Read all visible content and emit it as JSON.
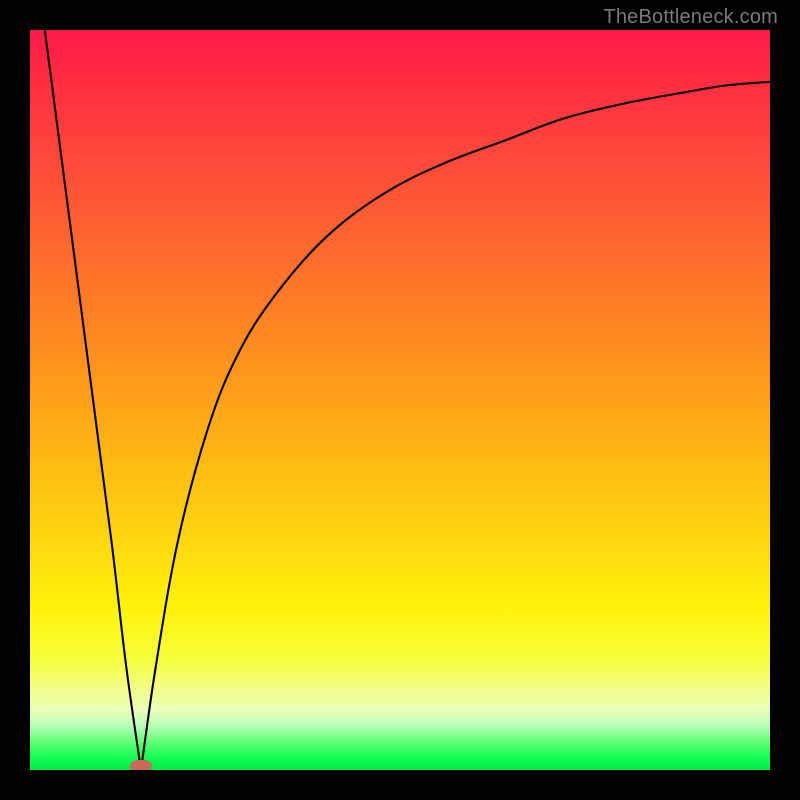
{
  "watermark": "TheBottleneck.com",
  "colors": {
    "frame": "#000000",
    "text": "#7a7a7a",
    "marker": "#c96a5a",
    "curve": "#000000"
  },
  "chart_data": {
    "type": "line",
    "title": "",
    "xlabel": "",
    "ylabel": "",
    "xlim": [
      0,
      100
    ],
    "ylim": [
      0,
      100
    ],
    "grid": false,
    "legend": false,
    "note": "Bottleneck-style curve: steep descent from 100 at x≈2 to 0 at x≈15, then asymptotic rise toward ~93 as x→100. Background gradient encodes y-value (red high → green low).",
    "series": [
      {
        "name": "curve",
        "x": [
          2,
          5,
          8,
          11,
          13,
          15,
          17,
          20,
          24,
          28,
          33,
          40,
          48,
          56,
          64,
          72,
          80,
          88,
          94,
          100
        ],
        "y": [
          100,
          77,
          54,
          31,
          14,
          0,
          14,
          31,
          46,
          56,
          64,
          72,
          78,
          82,
          85,
          88,
          90,
          91.5,
          92.5,
          93
        ]
      }
    ],
    "min_point": {
      "x": 15,
      "y": 0
    }
  }
}
